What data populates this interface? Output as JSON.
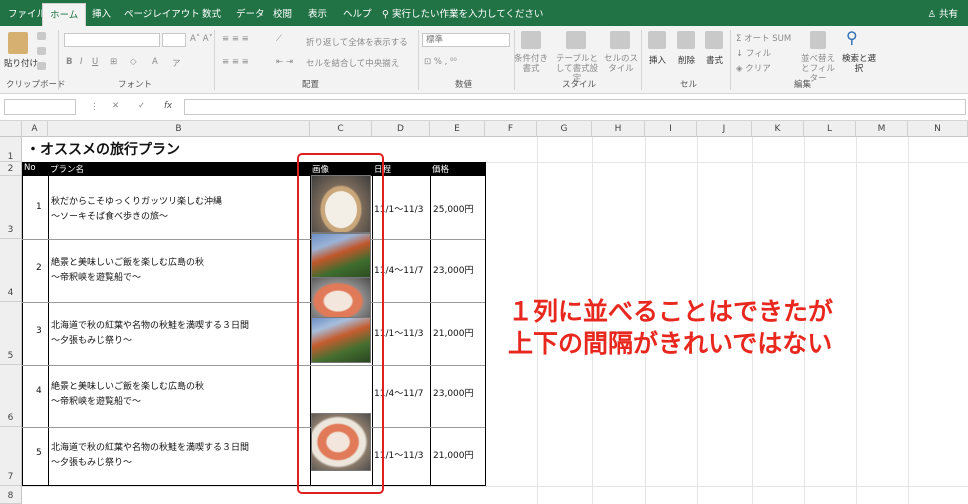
{
  "menu": {
    "tabs": [
      "ファイル",
      "ホーム",
      "挿入",
      "ページレイアウト",
      "数式",
      "データ",
      "校閲",
      "表示",
      "ヘルプ"
    ],
    "active_tab": "ホーム",
    "tell_me": "実行したい作業を入力してください",
    "share": "共有"
  },
  "ribbon": {
    "paste": "貼り付け",
    "clipboard_group": "クリップボード",
    "font_group": "フォント",
    "alignment_group": "配置",
    "number_group": "数値",
    "styles_group": "スタイル",
    "cells_group": "セル",
    "editing_group": "編集",
    "wrap_text": "折り返して全体を表示する",
    "merge_center": "セルを結合して中央揃え",
    "number_format": "標準",
    "conditional_format": "条件付き書式",
    "format_as_table": "テーブルとして書式設定",
    "cell_styles": "セルのスタイル",
    "insert": "挿入",
    "delete": "削除",
    "format": "書式",
    "autosum": "オート SUM",
    "fill": "フィル",
    "clear": "クリア",
    "sort_filter": "並べ替えとフィルター",
    "find_select": "検索と選択"
  },
  "formula_bar": {
    "name_box": "",
    "formula": "",
    "fx": "fx"
  },
  "sheet": {
    "columns": [
      "A",
      "B",
      "C",
      "D",
      "E",
      "F",
      "G",
      "H",
      "I",
      "J",
      "K",
      "L",
      "M",
      "N"
    ],
    "rows": [
      "1",
      "2",
      "3",
      "4",
      "5",
      "6",
      "7",
      "8"
    ],
    "title": "・オススメの旅行プラン",
    "headers": {
      "no": "No",
      "plan": "プラン名",
      "image": "画像",
      "dates": "日程",
      "price": "価格"
    },
    "plans": [
      {
        "no": "1",
        "name": "秋だからこそゆっくりガッツリ楽しむ沖縄",
        "sub": "～ソーキそば食べ歩きの旅～",
        "dates": "11/1～11/3",
        "price": "25,000円"
      },
      {
        "no": "2",
        "name": "絶景と美味しいご飯を楽しむ広島の秋",
        "sub": "～帝釈峡を遊覧船で～",
        "dates": "11/4～11/7",
        "price": "23,000円"
      },
      {
        "no": "3",
        "name": "北海道で秋の紅葉や名物の秋鮭を満喫する３日間",
        "sub": "～夕張もみじ祭り～",
        "dates": "11/1～11/3",
        "price": "21,000円"
      },
      {
        "no": "4",
        "name": "絶景と美味しいご飯を楽しむ広島の秋",
        "sub": "～帝釈峡を遊覧船で～",
        "dates": "11/4～11/7",
        "price": "23,000円"
      },
      {
        "no": "5",
        "name": "北海道で秋の紅葉や名物の秋鮭を満喫する３日間",
        "sub": "～夕張もみじ祭り～",
        "dates": "11/1～11/3",
        "price": "21,000円"
      }
    ]
  },
  "annotation": {
    "line1": "１列に並べることはできたが",
    "line2": "上下の間隔がきれいではない",
    "color": "#e8281e"
  },
  "colors": {
    "excel_green": "#217346",
    "highlight_red": "#e02020"
  }
}
